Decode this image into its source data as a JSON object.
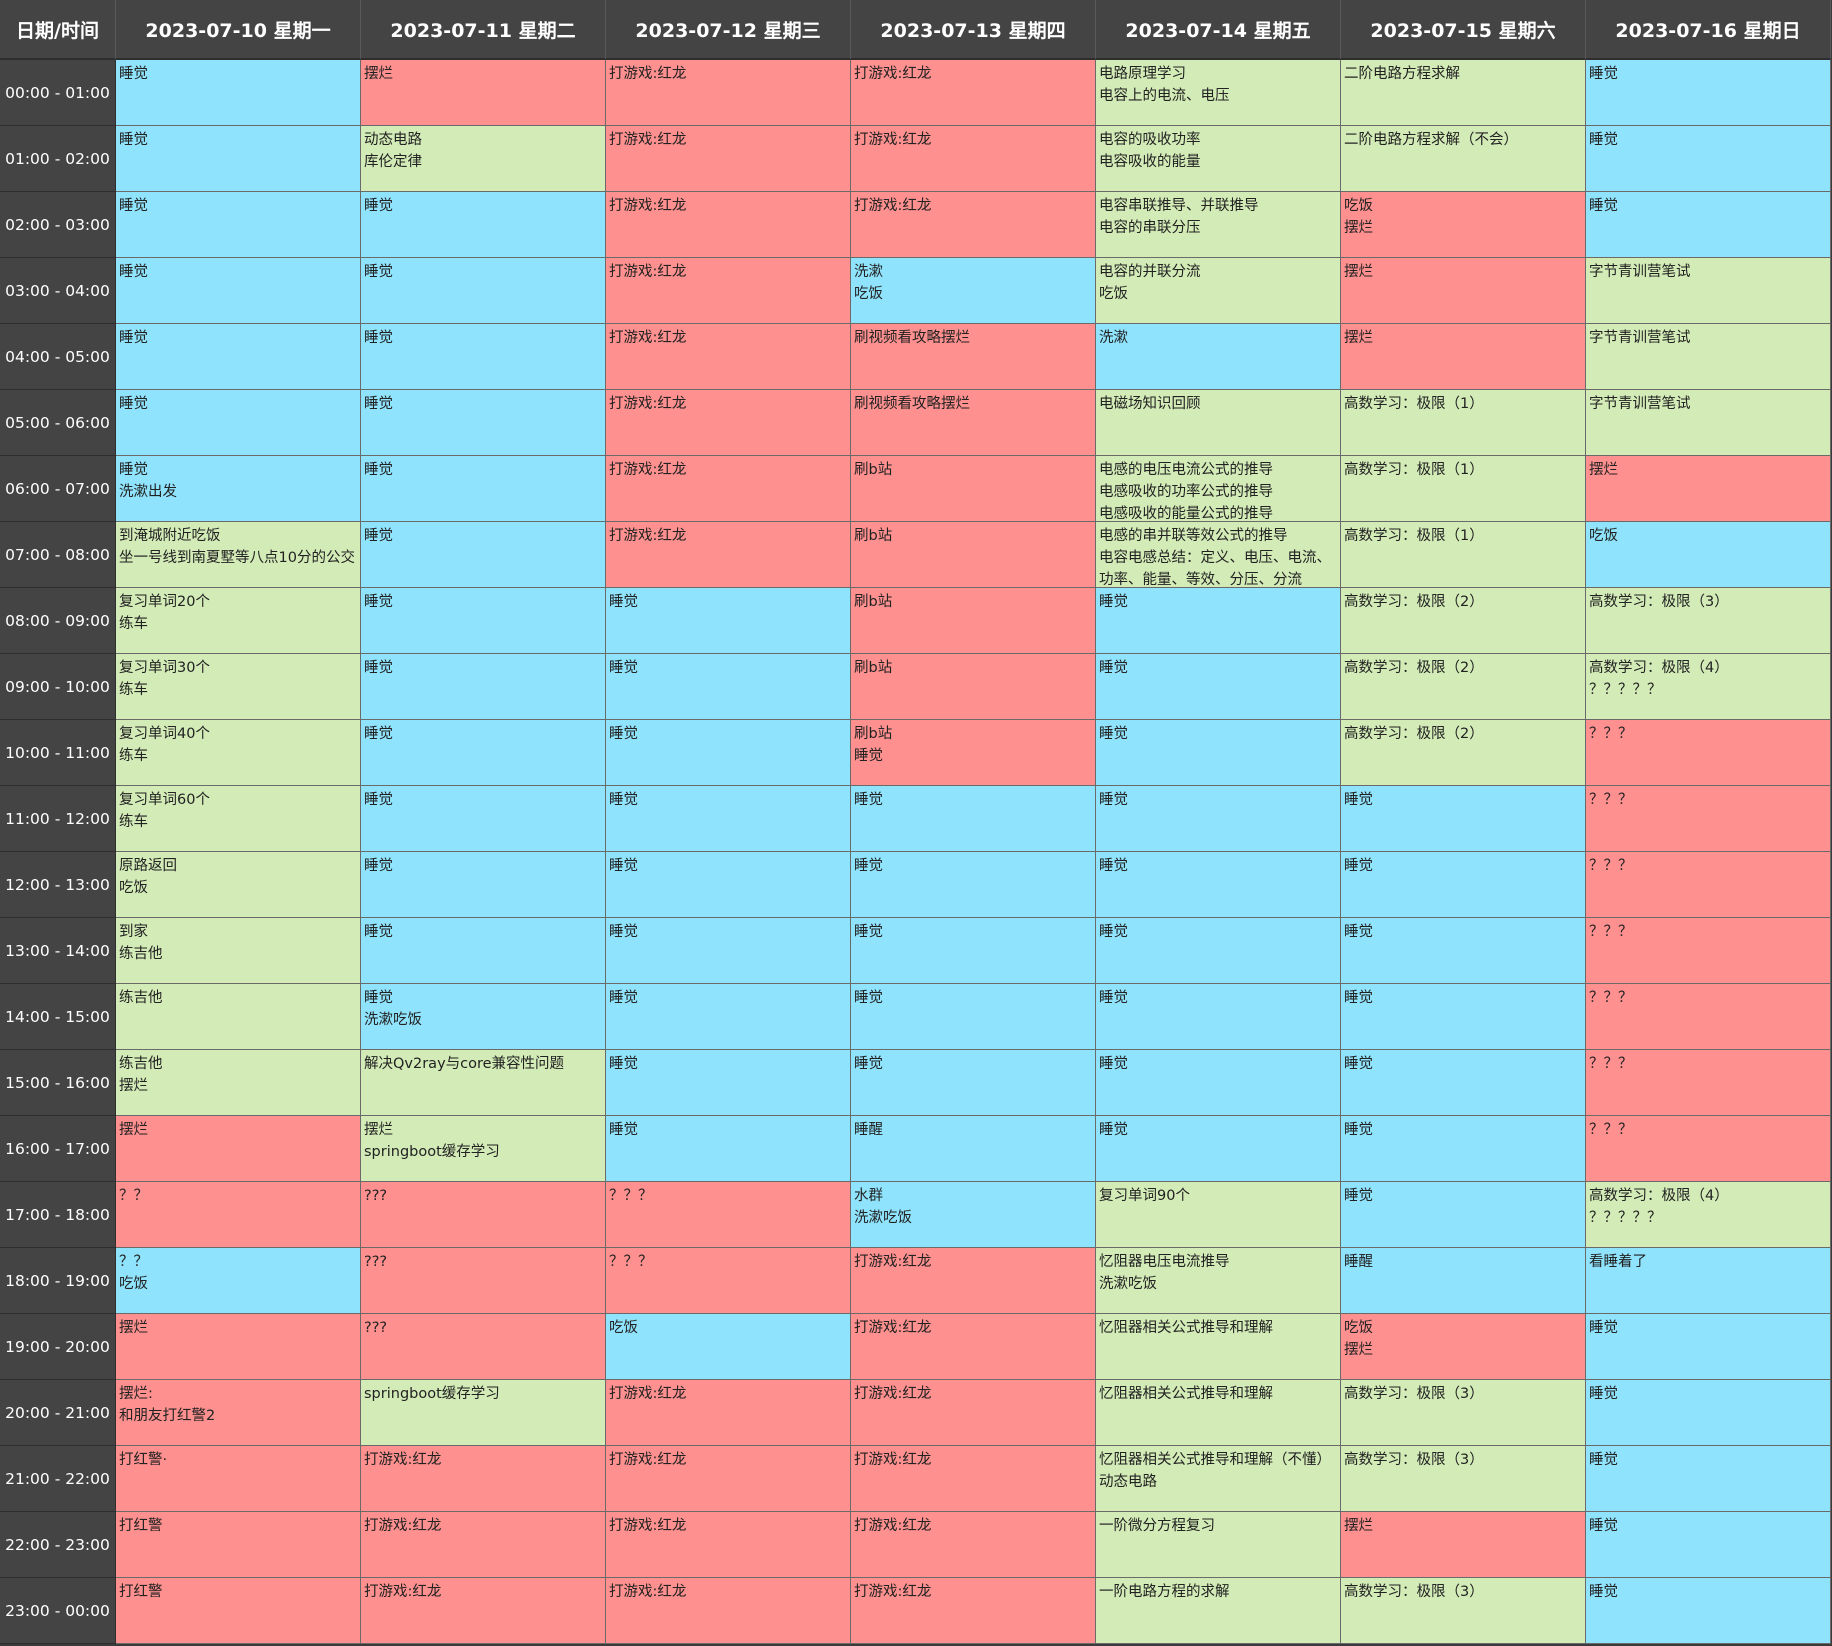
{
  "corner_label": "日期/时间",
  "colors": {
    "sleep": "#8fe3fc",
    "study": "#d3ebb7",
    "play": "#fe908f",
    "header": "#444444"
  },
  "days": [
    "2023-07-10 星期一",
    "2023-07-11 星期二",
    "2023-07-12 星期三",
    "2023-07-13 星期四",
    "2023-07-14 星期五",
    "2023-07-15 星期六",
    "2023-07-16 星期日"
  ],
  "rows": [
    {
      "time": "00:00 - 01:00",
      "cells": [
        {
          "text": "睡觉",
          "type": "sleep"
        },
        {
          "text": "摆烂",
          "type": "play"
        },
        {
          "text": "打游戏:红龙",
          "type": "play"
        },
        {
          "text": "打游戏:红龙",
          "type": "play"
        },
        {
          "text": "电路原理学习\n电容上的电流、电压",
          "type": "study"
        },
        {
          "text": "二阶电路方程求解",
          "type": "study"
        },
        {
          "text": "睡觉",
          "type": "sleep"
        }
      ]
    },
    {
      "time": "01:00 - 02:00",
      "cells": [
        {
          "text": "睡觉",
          "type": "sleep"
        },
        {
          "text": "动态电路\n库伦定律",
          "type": "study"
        },
        {
          "text": "打游戏:红龙",
          "type": "play"
        },
        {
          "text": "打游戏:红龙",
          "type": "play"
        },
        {
          "text": "电容的吸收功率\n电容吸收的能量",
          "type": "study"
        },
        {
          "text": "二阶电路方程求解（不会）",
          "type": "study"
        },
        {
          "text": "睡觉",
          "type": "sleep"
        }
      ]
    },
    {
      "time": "02:00 - 03:00",
      "cells": [
        {
          "text": "睡觉",
          "type": "sleep"
        },
        {
          "text": "睡觉",
          "type": "sleep"
        },
        {
          "text": "打游戏:红龙",
          "type": "play"
        },
        {
          "text": "打游戏:红龙",
          "type": "play"
        },
        {
          "text": "电容串联推导、并联推导\n电容的串联分压",
          "type": "study"
        },
        {
          "text": "吃饭\n摆烂",
          "type": "play"
        },
        {
          "text": "睡觉",
          "type": "sleep"
        }
      ]
    },
    {
      "time": "03:00 - 04:00",
      "cells": [
        {
          "text": "睡觉",
          "type": "sleep"
        },
        {
          "text": "睡觉",
          "type": "sleep"
        },
        {
          "text": "打游戏:红龙",
          "type": "play"
        },
        {
          "text": "洗漱\n吃饭",
          "type": "sleep"
        },
        {
          "text": "电容的并联分流\n吃饭",
          "type": "study"
        },
        {
          "text": "摆烂",
          "type": "play"
        },
        {
          "text": "字节青训营笔试",
          "type": "study"
        }
      ]
    },
    {
      "time": "04:00 - 05:00",
      "cells": [
        {
          "text": "睡觉",
          "type": "sleep"
        },
        {
          "text": "睡觉",
          "type": "sleep"
        },
        {
          "text": "打游戏:红龙",
          "type": "play"
        },
        {
          "text": "刷视频看攻略摆烂",
          "type": "play"
        },
        {
          "text": "洗漱",
          "type": "sleep"
        },
        {
          "text": "摆烂",
          "type": "play"
        },
        {
          "text": "字节青训营笔试",
          "type": "study"
        }
      ]
    },
    {
      "time": "05:00 - 06:00",
      "cells": [
        {
          "text": "睡觉",
          "type": "sleep"
        },
        {
          "text": "睡觉",
          "type": "sleep"
        },
        {
          "text": "打游戏:红龙",
          "type": "play"
        },
        {
          "text": "刷视频看攻略摆烂",
          "type": "play"
        },
        {
          "text": "电磁场知识回顾",
          "type": "study"
        },
        {
          "text": "高数学习：极限（1）",
          "type": "study"
        },
        {
          "text": "字节青训营笔试",
          "type": "study"
        }
      ]
    },
    {
      "time": "06:00 - 07:00",
      "cells": [
        {
          "text": "睡觉\n洗漱出发",
          "type": "sleep"
        },
        {
          "text": "睡觉",
          "type": "sleep"
        },
        {
          "text": "打游戏:红龙",
          "type": "play"
        },
        {
          "text": "刷b站",
          "type": "play"
        },
        {
          "text": "电感的电压电流公式的推导\n电感吸收的功率公式的推导\n电感吸收的能量公式的推导",
          "type": "study"
        },
        {
          "text": "高数学习：极限（1）",
          "type": "study"
        },
        {
          "text": "摆烂",
          "type": "play"
        }
      ]
    },
    {
      "time": "07:00 - 08:00",
      "cells": [
        {
          "text": "到淹城附近吃饭\n坐一号线到南夏墅等八点10分的公交",
          "type": "study"
        },
        {
          "text": "睡觉",
          "type": "sleep"
        },
        {
          "text": "打游戏:红龙",
          "type": "play"
        },
        {
          "text": "刷b站",
          "type": "play"
        },
        {
          "text": "电感的串并联等效公式的推导\n电容电感总结：定义、电压、电流、功率、能量、等效、分压、分流",
          "type": "study"
        },
        {
          "text": "高数学习：极限（1）",
          "type": "study"
        },
        {
          "text": "吃饭",
          "type": "sleep"
        }
      ]
    },
    {
      "time": "08:00 - 09:00",
      "cells": [
        {
          "text": "复习单词20个\n练车",
          "type": "study"
        },
        {
          "text": "睡觉",
          "type": "sleep"
        },
        {
          "text": "睡觉",
          "type": "sleep"
        },
        {
          "text": "刷b站",
          "type": "play"
        },
        {
          "text": "睡觉",
          "type": "sleep"
        },
        {
          "text": "高数学习：极限（2）",
          "type": "study"
        },
        {
          "text": "高数学习：极限（3）",
          "type": "study"
        }
      ]
    },
    {
      "time": "09:00 - 10:00",
      "cells": [
        {
          "text": "复习单词30个\n练车",
          "type": "study"
        },
        {
          "text": "睡觉",
          "type": "sleep"
        },
        {
          "text": "睡觉",
          "type": "sleep"
        },
        {
          "text": "刷b站",
          "type": "play"
        },
        {
          "text": "睡觉",
          "type": "sleep"
        },
        {
          "text": "高数学习：极限（2）",
          "type": "study"
        },
        {
          "text": "高数学习：极限（4）\n？？？？？",
          "type": "study"
        }
      ]
    },
    {
      "time": "10:00 - 11:00",
      "cells": [
        {
          "text": "复习单词40个\n练车",
          "type": "study"
        },
        {
          "text": "睡觉",
          "type": "sleep"
        },
        {
          "text": "睡觉",
          "type": "sleep"
        },
        {
          "text": "刷b站\n睡觉",
          "type": "play"
        },
        {
          "text": "睡觉",
          "type": "sleep"
        },
        {
          "text": "高数学习：极限（2）",
          "type": "study"
        },
        {
          "text": "？？？",
          "type": "play"
        }
      ]
    },
    {
      "time": "11:00 - 12:00",
      "cells": [
        {
          "text": "复习单词60个\n练车",
          "type": "study"
        },
        {
          "text": "睡觉",
          "type": "sleep"
        },
        {
          "text": "睡觉",
          "type": "sleep"
        },
        {
          "text": "睡觉",
          "type": "sleep"
        },
        {
          "text": "睡觉",
          "type": "sleep"
        },
        {
          "text": "睡觉",
          "type": "sleep"
        },
        {
          "text": "？？？",
          "type": "play"
        }
      ]
    },
    {
      "time": "12:00 - 13:00",
      "cells": [
        {
          "text": "原路返回\n吃饭",
          "type": "study"
        },
        {
          "text": "睡觉",
          "type": "sleep"
        },
        {
          "text": "睡觉",
          "type": "sleep"
        },
        {
          "text": "睡觉",
          "type": "sleep"
        },
        {
          "text": "睡觉",
          "type": "sleep"
        },
        {
          "text": "睡觉",
          "type": "sleep"
        },
        {
          "text": "？？？",
          "type": "play"
        }
      ]
    },
    {
      "time": "13:00 - 14:00",
      "cells": [
        {
          "text": "到家\n练吉他",
          "type": "study"
        },
        {
          "text": "睡觉",
          "type": "sleep"
        },
        {
          "text": "睡觉",
          "type": "sleep"
        },
        {
          "text": "睡觉",
          "type": "sleep"
        },
        {
          "text": "睡觉",
          "type": "sleep"
        },
        {
          "text": "睡觉",
          "type": "sleep"
        },
        {
          "text": "？？？",
          "type": "play"
        }
      ]
    },
    {
      "time": "14:00 - 15:00",
      "cells": [
        {
          "text": "练吉他",
          "type": "study"
        },
        {
          "text": "睡觉\n洗漱吃饭",
          "type": "sleep"
        },
        {
          "text": "睡觉",
          "type": "sleep"
        },
        {
          "text": "睡觉",
          "type": "sleep"
        },
        {
          "text": "睡觉",
          "type": "sleep"
        },
        {
          "text": "睡觉",
          "type": "sleep"
        },
        {
          "text": "？？？",
          "type": "play"
        }
      ]
    },
    {
      "time": "15:00 - 16:00",
      "cells": [
        {
          "text": "练吉他\n摆烂",
          "type": "study"
        },
        {
          "text": "解决Qv2ray与core兼容性问题",
          "type": "study"
        },
        {
          "text": "睡觉",
          "type": "sleep"
        },
        {
          "text": "睡觉",
          "type": "sleep"
        },
        {
          "text": "睡觉",
          "type": "sleep"
        },
        {
          "text": "睡觉",
          "type": "sleep"
        },
        {
          "text": "？？？",
          "type": "play"
        }
      ]
    },
    {
      "time": "16:00 - 17:00",
      "cells": [
        {
          "text": "摆烂",
          "type": "play"
        },
        {
          "text": "摆烂\nspringboot缓存学习",
          "type": "study"
        },
        {
          "text": "睡觉",
          "type": "sleep"
        },
        {
          "text": "睡醒",
          "type": "sleep"
        },
        {
          "text": "睡觉",
          "type": "sleep"
        },
        {
          "text": "睡觉",
          "type": "sleep"
        },
        {
          "text": "？？？",
          "type": "play"
        }
      ]
    },
    {
      "time": "17:00 - 18:00",
      "cells": [
        {
          "text": "？？",
          "type": "play"
        },
        {
          "text": "???",
          "type": "play"
        },
        {
          "text": "？？？",
          "type": "play"
        },
        {
          "text": "水群\n洗漱吃饭",
          "type": "sleep"
        },
        {
          "text": "复习单词90个",
          "type": "study"
        },
        {
          "text": "睡觉",
          "type": "sleep"
        },
        {
          "text": "高数学习：极限（4）\n？？？？？",
          "type": "study"
        }
      ]
    },
    {
      "time": "18:00 - 19:00",
      "cells": [
        {
          "text": "？？\n吃饭",
          "type": "sleep"
        },
        {
          "text": "???",
          "type": "play"
        },
        {
          "text": "？？？",
          "type": "play"
        },
        {
          "text": "打游戏:红龙",
          "type": "play"
        },
        {
          "text": "忆阻器电压电流推导\n洗漱吃饭",
          "type": "study"
        },
        {
          "text": "睡醒",
          "type": "sleep"
        },
        {
          "text": "看睡着了",
          "type": "sleep"
        }
      ]
    },
    {
      "time": "19:00 - 20:00",
      "cells": [
        {
          "text": "摆烂",
          "type": "play"
        },
        {
          "text": "???",
          "type": "play"
        },
        {
          "text": "吃饭",
          "type": "sleep"
        },
        {
          "text": "打游戏:红龙",
          "type": "play"
        },
        {
          "text": "忆阻器相关公式推导和理解",
          "type": "study"
        },
        {
          "text": "吃饭\n摆烂",
          "type": "play"
        },
        {
          "text": "睡觉",
          "type": "sleep"
        }
      ]
    },
    {
      "time": "20:00 - 21:00",
      "cells": [
        {
          "text": "摆烂:\n和朋友打红警2",
          "type": "play"
        },
        {
          "text": "springboot缓存学习",
          "type": "study"
        },
        {
          "text": "打游戏:红龙",
          "type": "play"
        },
        {
          "text": "打游戏:红龙",
          "type": "play"
        },
        {
          "text": "忆阻器相关公式推导和理解",
          "type": "study"
        },
        {
          "text": "高数学习：极限（3）",
          "type": "study"
        },
        {
          "text": "睡觉",
          "type": "sleep"
        }
      ]
    },
    {
      "time": "21:00 - 22:00",
      "cells": [
        {
          "text": "打红警·",
          "type": "play"
        },
        {
          "text": "打游戏:红龙",
          "type": "play"
        },
        {
          "text": "打游戏:红龙",
          "type": "play"
        },
        {
          "text": "打游戏:红龙",
          "type": "play"
        },
        {
          "text": "忆阻器相关公式推导和理解（不懂）\n动态电路",
          "type": "study"
        },
        {
          "text": "高数学习：极限（3）",
          "type": "study"
        },
        {
          "text": "睡觉",
          "type": "sleep"
        }
      ]
    },
    {
      "time": "22:00 - 23:00",
      "cells": [
        {
          "text": "打红警",
          "type": "play"
        },
        {
          "text": "打游戏:红龙",
          "type": "play"
        },
        {
          "text": "打游戏:红龙",
          "type": "play"
        },
        {
          "text": "打游戏:红龙",
          "type": "play"
        },
        {
          "text": "一阶微分方程复习",
          "type": "study"
        },
        {
          "text": "摆烂",
          "type": "play"
        },
        {
          "text": "睡觉",
          "type": "sleep"
        }
      ]
    },
    {
      "time": "23:00 - 00:00",
      "cells": [
        {
          "text": "打红警",
          "type": "play"
        },
        {
          "text": "打游戏:红龙",
          "type": "play"
        },
        {
          "text": "打游戏:红龙",
          "type": "play"
        },
        {
          "text": "打游戏:红龙",
          "type": "play"
        },
        {
          "text": "一阶电路方程的求解",
          "type": "study"
        },
        {
          "text": "高数学习：极限（3）",
          "type": "study"
        },
        {
          "text": "睡觉",
          "type": "sleep"
        }
      ]
    }
  ]
}
